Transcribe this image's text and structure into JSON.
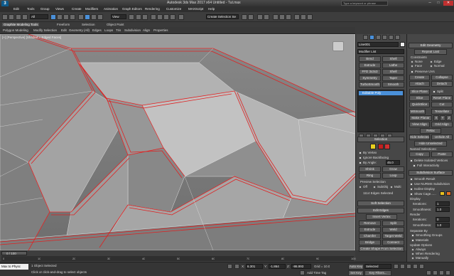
{
  "window": {
    "app_title": "Autodesk 3ds Max 2017 x64",
    "file_name": "Untitled - Tut.max",
    "search_placeholder": "Type a keyword or phrase"
  },
  "menu": {
    "items": [
      "Edit",
      "Tools",
      "Group",
      "Views",
      "Create",
      "Modifiers",
      "Animation",
      "Graph Editors",
      "Rendering",
      "Customize",
      "MAXScript",
      "Help"
    ],
    "filter_value": "All",
    "view_value": "View",
    "selection_set_placeholder": "Create Selection Se"
  },
  "ribbon": {
    "tabs": [
      "Graphite Modeling Tools",
      "Freeform",
      "Selection",
      "Object Paint"
    ],
    "subtabs": [
      "Polygon Modeling",
      "Modify Selection",
      "Edit",
      "Geometry (All)",
      "Edges",
      "Loops",
      "Tris",
      "Subdivision",
      "Align",
      "Properties"
    ]
  },
  "viewport": {
    "label": "[+] [Perspective] [Shaded + Edged Faces]"
  },
  "command_panel": {
    "object_name": "Line001",
    "modifier_list_label": "Modifier List",
    "modifier_buttons": [
      "Bend",
      "Shell",
      "Extrude",
      "Lathe",
      "FFD 3x3x3",
      "Shell",
      "Symmetry",
      "Taper",
      "TurboSmooth",
      "Smooth"
    ],
    "stack_item": "Editable Poly",
    "selection_rollout": "Selection",
    "by_vertex": "By Vertex",
    "ignore_backfacing": "Ignore Backfacing",
    "by_angle_label": "By Angle:",
    "by_angle_value": "45.0",
    "shrink": "Shrink",
    "grow": "Grow",
    "ring": "Ring",
    "loop": "Loop",
    "preview_selection": "Preview Selection",
    "preview_off": "Off",
    "preview_subobj": "SubObj",
    "preview_multi": "Multi",
    "selection_status": "1114 Edges Selected",
    "soft_selection": "Soft Selection",
    "edit_edges": "Edit Edges",
    "insert_vertex": "Insert Vertex",
    "remove": "Remove",
    "split": "Split",
    "extrude": "Extrude",
    "weld": "Weld",
    "chamfer": "Chamfer",
    "target_weld": "Target Weld",
    "bridge": "Bridge",
    "connect": "Connect",
    "create_shape": "Create Shape From Selection",
    "weight_label": "Weight:",
    "weight_value": "1.0",
    "crease_label": "Crease:",
    "crease_value": "0.0"
  },
  "right_panel": {
    "edit_geometry": "Edit Geometry",
    "repeat_last": "Repeat Last",
    "constraints": "Constraints",
    "none": "None",
    "edge": "Edge",
    "face": "Face",
    "normal": "Normal",
    "preserve_uvs": "Preserve UVs",
    "create": "Create",
    "collapse": "Collapse",
    "attach": "Attach",
    "detach": "Detach",
    "slice_plane": "Slice Plane",
    "split": "Split",
    "slice": "Slice",
    "reset_plane": "Reset Plane",
    "quickslice": "QuickSlice",
    "cut": "Cut",
    "msmooth": "MSmooth",
    "tessellate": "Tessellate",
    "make_planar": "Make Planar",
    "x": "X",
    "y": "Y",
    "z": "Z",
    "view_align": "View Align",
    "grid_align": "Grid Align",
    "relax": "Relax",
    "hide_selected": "Hide Selected",
    "unhide_all": "Unhide All",
    "hide_unselected": "Hide Unselected",
    "named_selections": "Named Selections:",
    "copy": "Copy",
    "paste": "Paste",
    "delete_isolated": "Delete Isolated Vertices",
    "full_interactivity": "Full Interactivity",
    "subdivision_surface": "Subdivision Surface",
    "smooth_result": "Smooth Result",
    "use_nurms": "Use NURMS Subdivision",
    "isoline_display": "Isoline Display",
    "show_cage": "Show Cage......",
    "display": "Display",
    "iterations_label": "Iterations:",
    "iterations_value": "1",
    "smoothness_label": "Smoothness:",
    "smoothness_value": "1.0",
    "render": "Render",
    "render_iterations": "0",
    "render_smoothness": "1.0",
    "separate_by": "Separate By",
    "smoothing_groups": "Smoothing Groups",
    "materials": "Materials",
    "update_options": "Update Options",
    "always": "Always",
    "when_rendering": "When Rendering",
    "manually": "Manually",
    "cage_color_1": "#e8c020",
    "cage_color_2": "#e87020"
  },
  "timeline": {
    "frame_display": "0 / 100",
    "ticks": [
      "0",
      "10",
      "20",
      "30",
      "40",
      "50",
      "60",
      "70",
      "80",
      "90",
      "100"
    ]
  },
  "status": {
    "maxscript_text": "Max to Physc",
    "objects_selected": "1 Object Selected",
    "prompt": "Click or click-and-drag to select objects",
    "x_label": "X:",
    "x_value": "6.301",
    "y_label": "Y:",
    "y_value": "-1.864",
    "z_label": "Z:",
    "z_value": "-86.993",
    "grid_label": "Grid = 10.0",
    "add_time_tag": "Add Time Tag",
    "auto_key": "Auto Key",
    "selected_value": "Selected",
    "set_key": "Set Key",
    "key_filters": "Key Filters..."
  },
  "colors": {
    "selected_edge": "#e02020",
    "viewport_bg": "#7a7a7a",
    "panel_bg": "#474747",
    "accent_blue": "#4a90d9"
  }
}
